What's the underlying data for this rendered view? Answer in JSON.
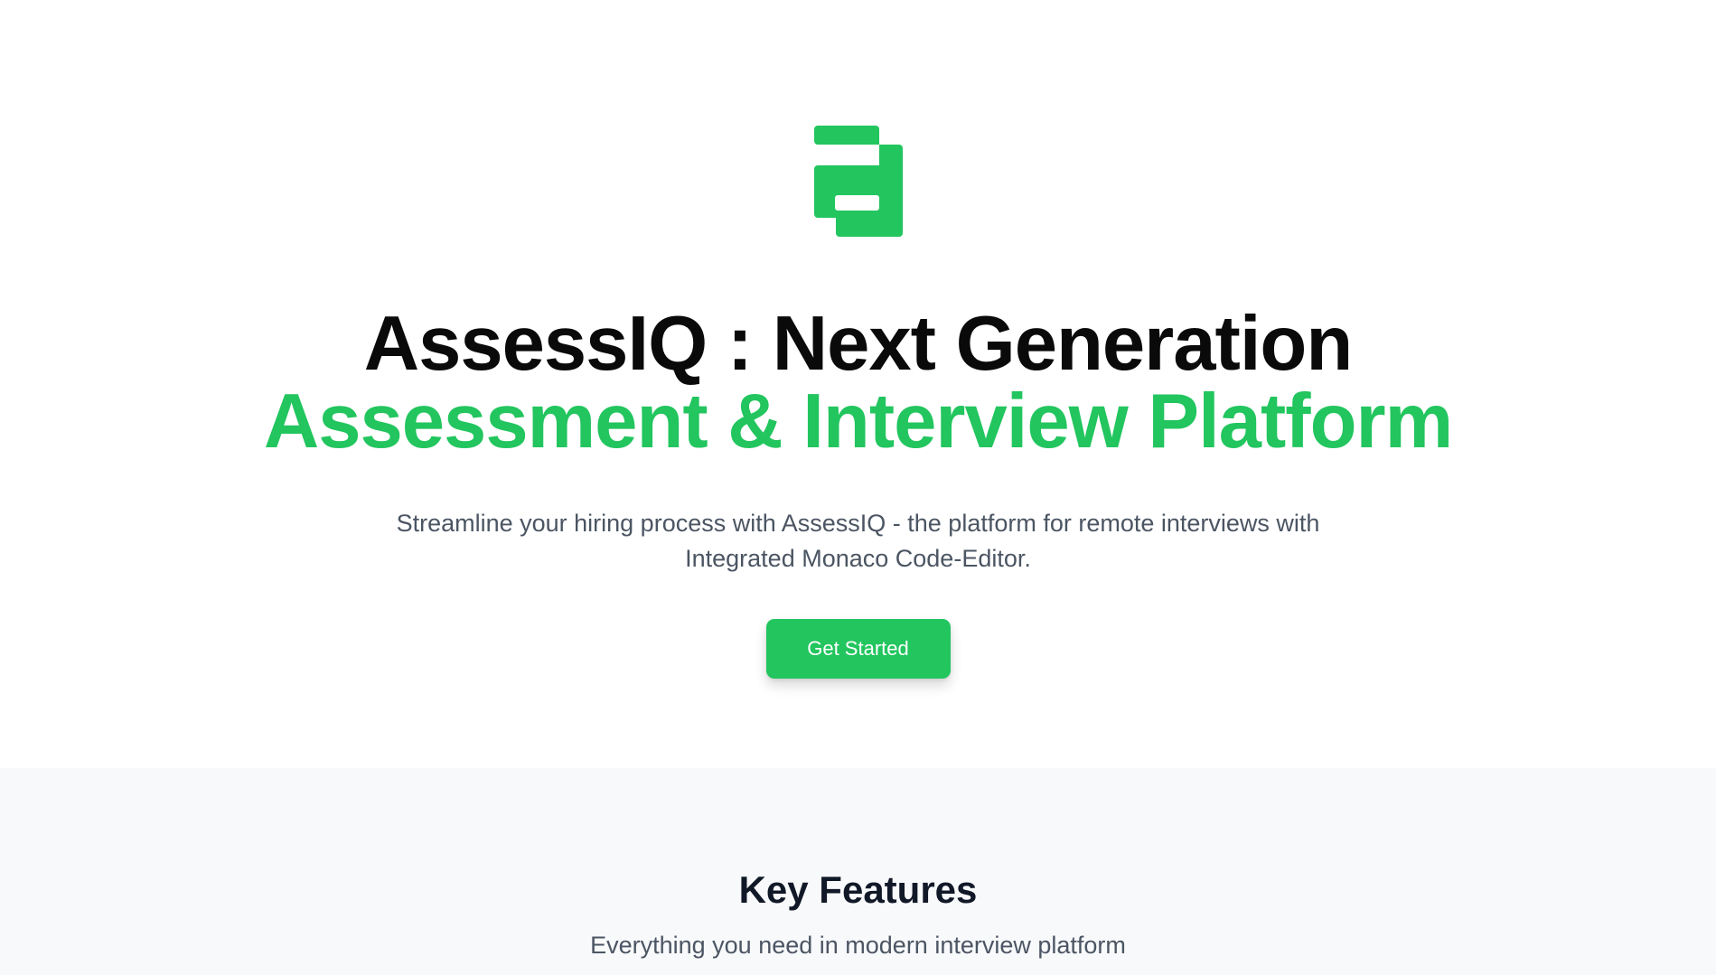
{
  "brand": {
    "logo_icon": "assessiq-logo-icon",
    "accent_color": "#22c55e"
  },
  "hero": {
    "title_line1": "AssessIQ : Next Generation",
    "title_line2": "Assessment & Interview Platform",
    "subtitle": "Streamline your hiring process with AssessIQ - the platform for remote interviews with Integrated Monaco Code-Editor.",
    "cta_label": "Get Started"
  },
  "features": {
    "heading": "Key Features",
    "subheading": "Everything you need in modern interview platform"
  }
}
